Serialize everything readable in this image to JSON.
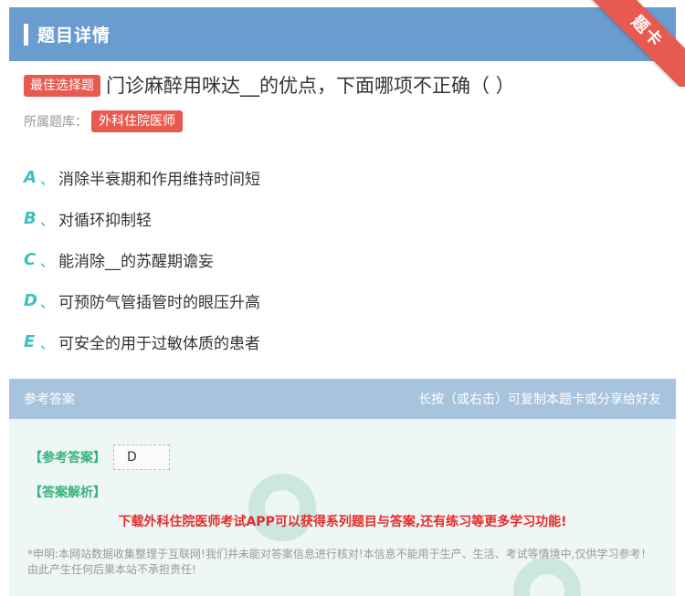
{
  "header": {
    "title": "题目详情"
  },
  "ribbon": {
    "label": "题卡"
  },
  "question": {
    "type_badge": "最佳选择题",
    "text": "门诊麻醉用咪达__的优点，下面哪项不正确（ ）",
    "bank_label": "所属题库：",
    "bank_name": "外科住院医师"
  },
  "options": [
    {
      "letter": "A",
      "sep": "、",
      "text": "消除半衰期和作用维持时间短"
    },
    {
      "letter": "B",
      "sep": "、",
      "text": "对循环抑制轻"
    },
    {
      "letter": "C",
      "sep": "、",
      "text": "能消除__的苏醒期谵妄"
    },
    {
      "letter": "D",
      "sep": "、",
      "text": "可预防气管插管时的眼压升高"
    },
    {
      "letter": "E",
      "sep": "、",
      "text": "可安全的用于过敏体质的患者"
    }
  ],
  "answer_section": {
    "header_left": "参考答案",
    "header_right": "长按（或右击）可复制本题卡或分享给好友",
    "ref_label": "【参考答案】",
    "ref_value": "D",
    "analysis_label": "【答案解析】",
    "promo": "下载外科住院医师考试APP可以获得系列题目与答案,还有练习等更多学习功能!",
    "notice": "*申明:本网站数据收集整理于互联网!我们并未能对答案信息进行核对!本信息不能用于生产、生活、考试等情境中,仅供学习参考！由此产生任何后果本站不承担责任!"
  },
  "colors": {
    "header_bg": "#6a9ccf",
    "accent_red": "#e85a4f",
    "option_letter": "#3cbfbf",
    "answer_label": "#36b37e",
    "promo_red": "#e52b2b"
  }
}
